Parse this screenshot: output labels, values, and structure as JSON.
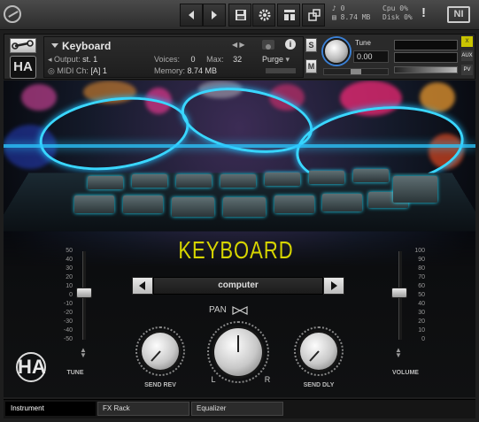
{
  "toolbar": {
    "cpu_label": "Cpu",
    "cpu_value": "0%",
    "disk_label": "Disk",
    "disk_value": "0%",
    "voices_value": "0",
    "memory_value": "8.74 MB",
    "alert": "!",
    "ni_logo": "NI"
  },
  "instrument": {
    "name": "Keyboard",
    "output_label": "Output:",
    "output_value": "st. 1",
    "midi_label": "MIDI Ch:",
    "midi_value": "[A] 1",
    "voices_label": "Voices:",
    "voices_value": "0",
    "max_label": "Max:",
    "max_value": "32",
    "purge_label": "Purge",
    "memory_label": "Memory:",
    "memory_value": "8.74 MB",
    "solo_label": "S",
    "mute_label": "M",
    "logo_text": "HA"
  },
  "tune": {
    "label": "Tune",
    "value": "0.00"
  },
  "side_tags": {
    "close": "X",
    "aux": "AUX",
    "pv": "PV"
  },
  "ui": {
    "title": "KEYBOARD",
    "preset_name": "computer",
    "pan_label": "PAN",
    "pan_left": "L",
    "pan_right": "R",
    "send_rev_label": "SEND REV",
    "send_dly_label": "SEND DLY",
    "tune_label": "TUNE",
    "volume_label": "VOLUME",
    "logo_text": "HA",
    "tune_scale": [
      "50",
      "40",
      "30",
      "20",
      "10",
      "0",
      "-10",
      "-20",
      "-30",
      "-40",
      "-50"
    ],
    "volume_scale": [
      "100",
      "90",
      "80",
      "70",
      "60",
      "50",
      "40",
      "30",
      "20",
      "10",
      "0"
    ]
  },
  "tabs": [
    {
      "label": "Instrument",
      "active": true
    },
    {
      "label": "FX Rack",
      "active": false
    },
    {
      "label": "Equalizer",
      "active": false
    }
  ],
  "colors": {
    "title_yellow": "#d6d400",
    "accent_blue": "#3a7fd3",
    "cable_cyan": "#3ad7ff"
  }
}
